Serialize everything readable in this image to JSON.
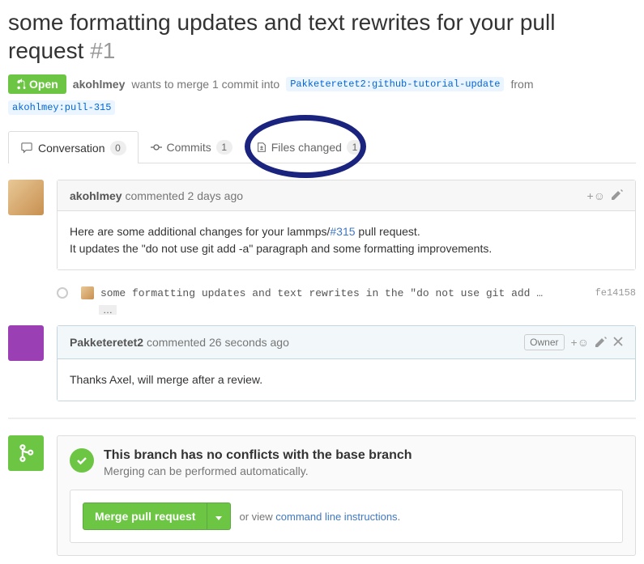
{
  "title": "some formatting updates and text rewrites for your pull request",
  "pr_number": "#1",
  "state": "Open",
  "merge_line": {
    "author": "akohlmey",
    "text1": "wants to merge 1 commit into",
    "base": "Pakketeretet2:github-tutorial-update",
    "text2": "from",
    "head": "akohlmey:pull-315"
  },
  "tabs": {
    "conversation": {
      "label": "Conversation",
      "count": "0"
    },
    "commits": {
      "label": "Commits",
      "count": "1"
    },
    "files": {
      "label": "Files changed",
      "count": "1"
    }
  },
  "comment1": {
    "author": "akohlmey",
    "action": "commented",
    "time": "2 days ago",
    "body1": "Here are some additional changes for your lammps/",
    "link": "#315",
    "body1b": " pull request.",
    "body2": "It updates the \"do not use git add -a\" paragraph and some formatting improvements."
  },
  "commit": {
    "msg": "some formatting updates and text rewrites in the \"do not use git add …",
    "sha": "fe14158"
  },
  "comment2": {
    "author": "Pakketeretet2",
    "action": "commented",
    "time": "26 seconds ago",
    "badge": "Owner",
    "body": "Thanks Axel, will merge after a review."
  },
  "merge": {
    "title": "This branch has no conflicts with the base branch",
    "sub": "Merging can be performed automatically.",
    "button": "Merge pull request",
    "text": "or view ",
    "link": "command line instructions",
    "period": "."
  },
  "colors": {
    "avatar1_bg": "#d4a968",
    "avatar2_bg": "#9b3fb5"
  }
}
